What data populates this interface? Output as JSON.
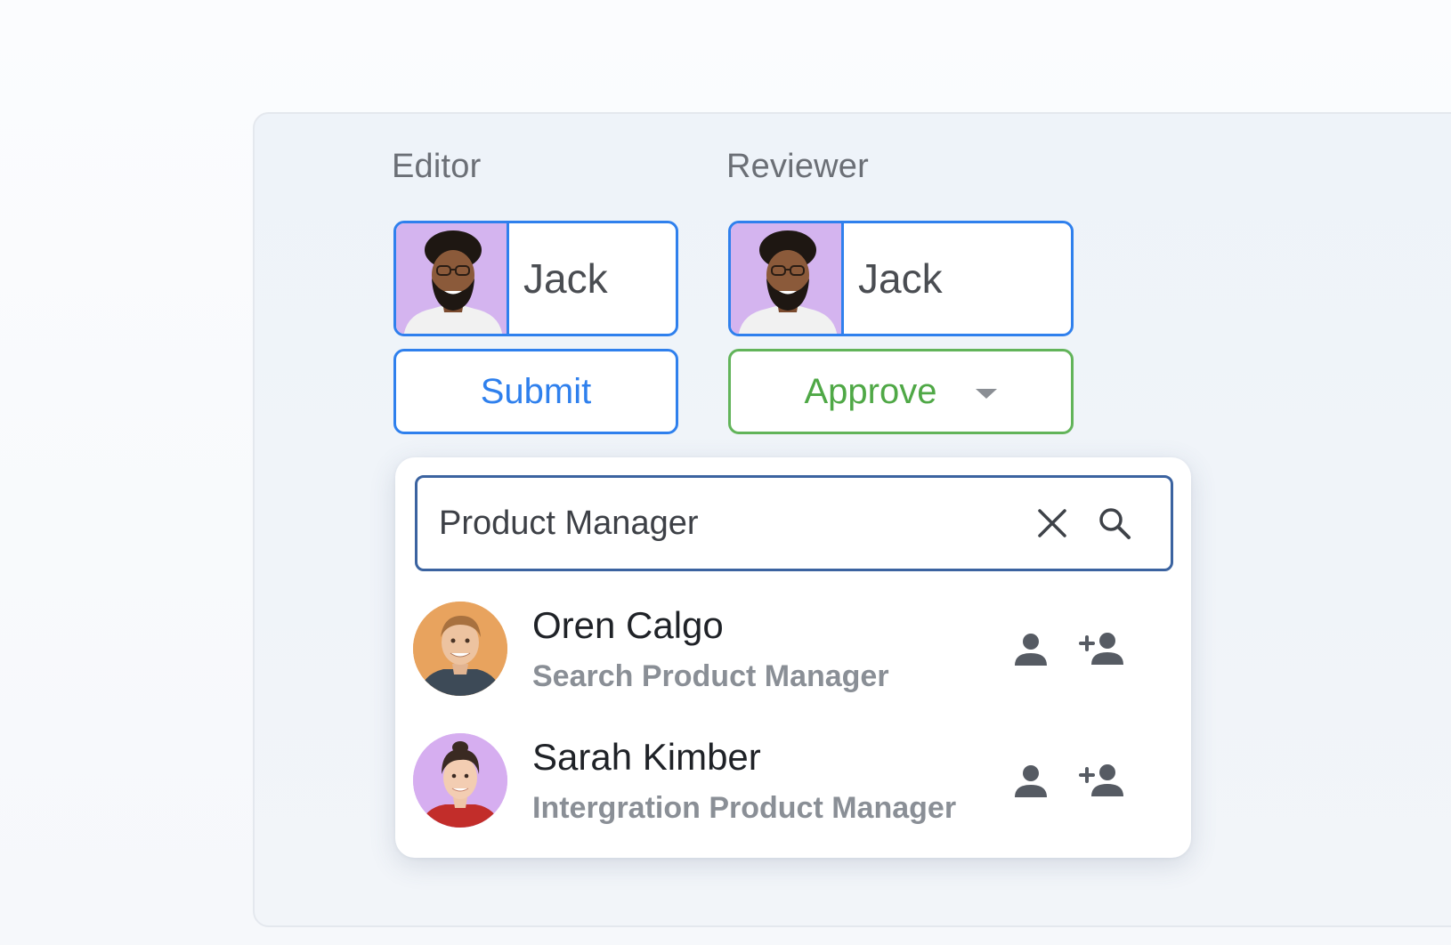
{
  "editor": {
    "label": "Editor",
    "assignee_name": "Jack",
    "action_label": "Submit"
  },
  "reviewer": {
    "label": "Reviewer",
    "assignee_name": "Jack",
    "action_label": "Approve"
  },
  "search": {
    "value": "Product Manager"
  },
  "results": [
    {
      "name": "Oren Calgo",
      "role": "Search Product Manager"
    },
    {
      "name": "Sarah Kimber",
      "role": "Intergration Product Manager"
    }
  ],
  "colors": {
    "primary_blue": "#2f80ed",
    "approve_green": "#4fa846",
    "chip_photo_bg": "#d4b4ef",
    "search_border": "#3b63a0",
    "icon_gray": "#565b63"
  },
  "icons": {
    "clear": "close-icon",
    "search": "search-icon",
    "assign": "person-icon",
    "add": "person-add-icon",
    "dropdown": "caret-down-icon"
  }
}
